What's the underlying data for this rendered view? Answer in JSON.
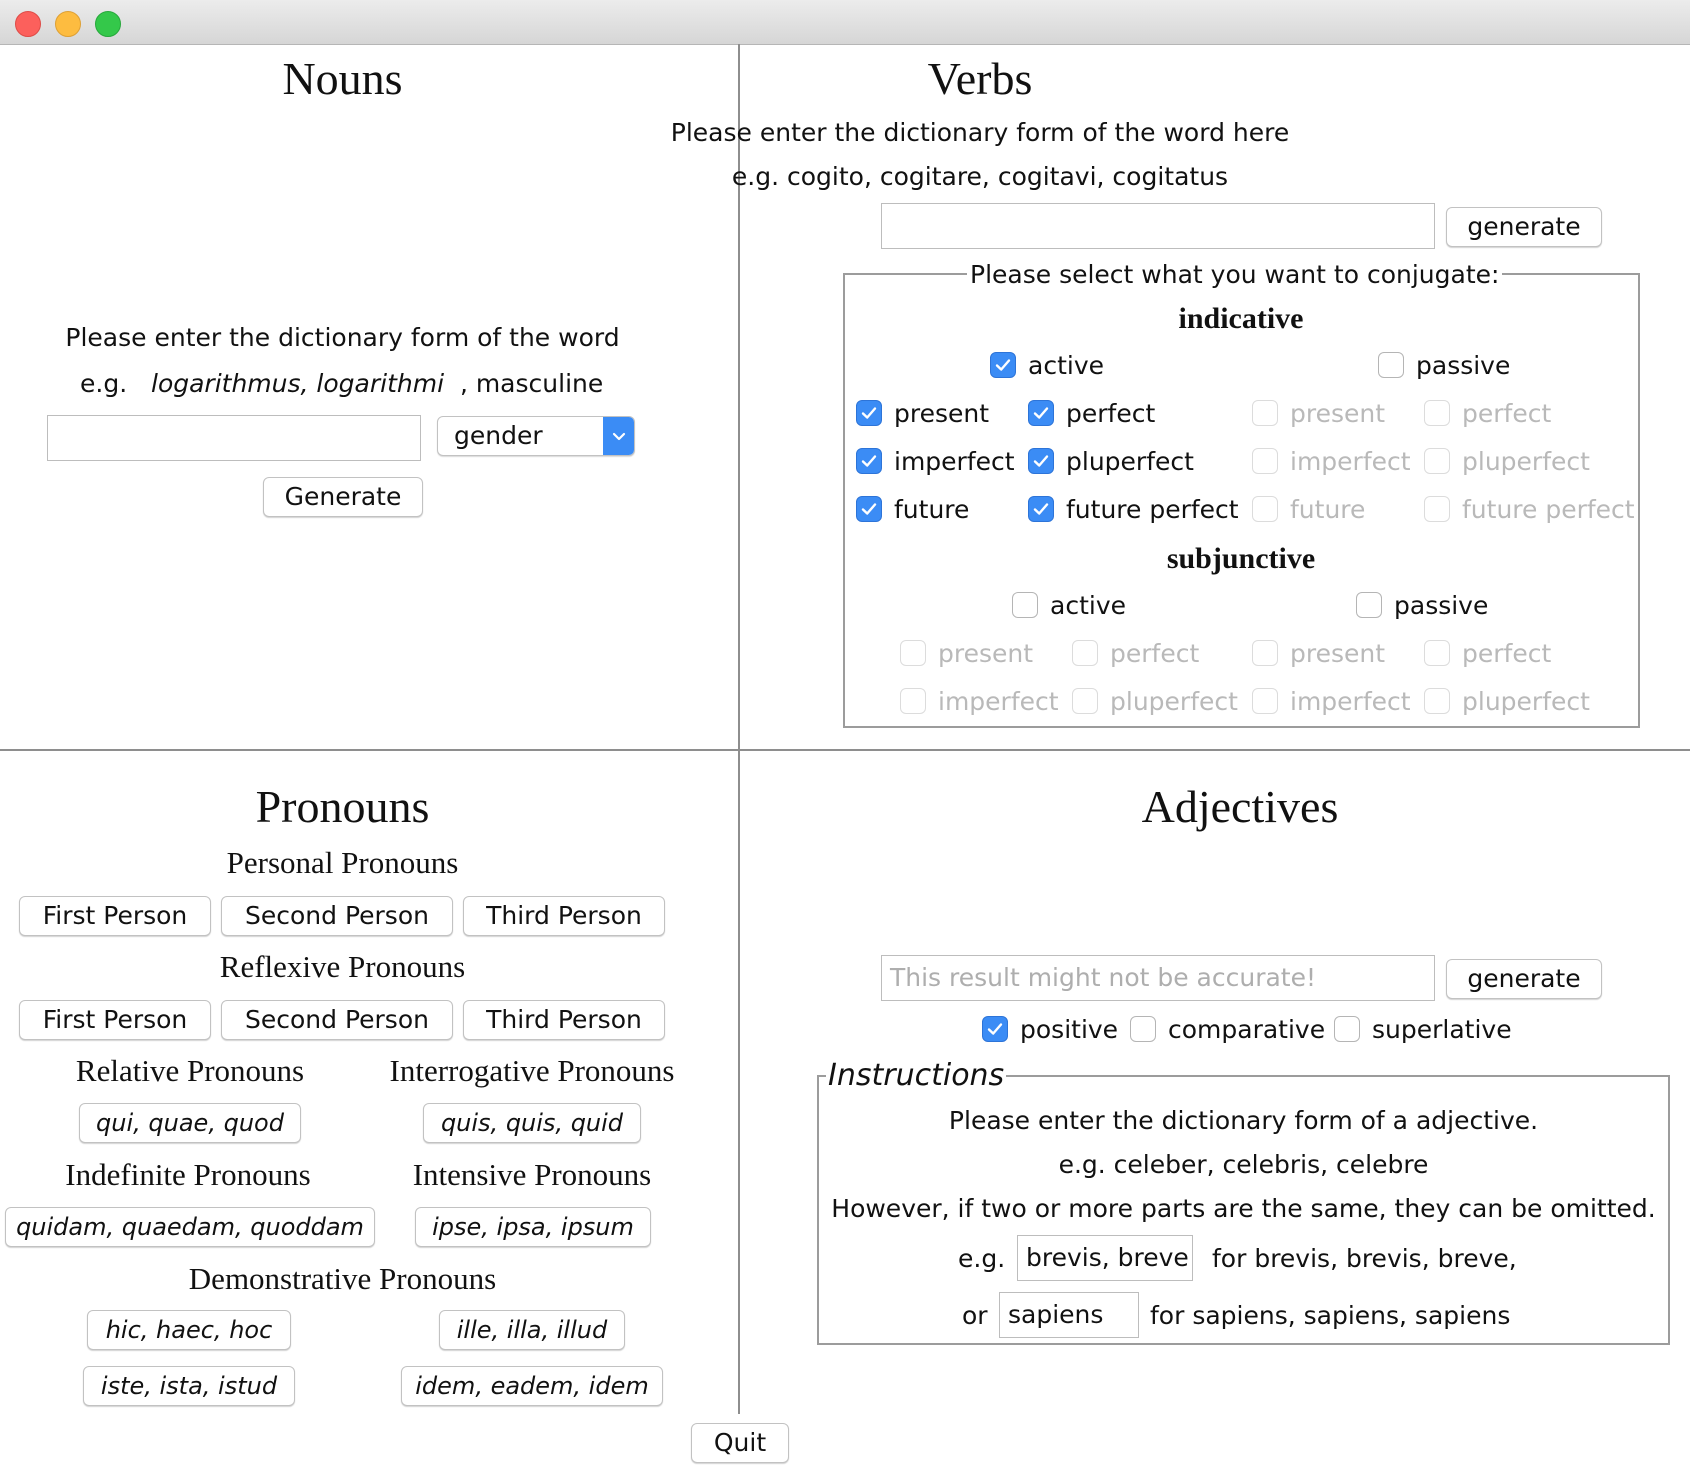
{
  "window": {
    "title": ""
  },
  "nouns": {
    "title": "Nouns",
    "instruction": "Please enter the dictionary form of the word",
    "example_prefix": "e.g.",
    "example_words": "logarithmus, logarithmi",
    "example_suffix": ", masculine",
    "input_value": "",
    "gender_select": "gender",
    "generate_label": "Generate"
  },
  "verbs": {
    "title": "Verbs",
    "instruction": "Please enter the dictionary form of the word here",
    "example": "e.g. cogito, cogitare, cogitavi, cogitatus",
    "input_value": "",
    "generate_label": "generate",
    "group_label": "Please select what you want to conjugate:",
    "indicative": {
      "label": "indicative",
      "active": {
        "label": "active",
        "checked": true
      },
      "passive": {
        "label": "passive",
        "checked": false
      },
      "active_tenses": {
        "present": {
          "label": "present",
          "checked": true
        },
        "perfect": {
          "label": "perfect",
          "checked": true
        },
        "imperfect": {
          "label": "imperfect",
          "checked": true
        },
        "pluperfect": {
          "label": "pluperfect",
          "checked": true
        },
        "future": {
          "label": "future",
          "checked": true
        },
        "future_perfect": {
          "label": "future perfect",
          "checked": true
        }
      },
      "passive_tenses": {
        "present": {
          "label": "present",
          "checked": false,
          "enabled": false
        },
        "perfect": {
          "label": "perfect",
          "checked": false,
          "enabled": false
        },
        "imperfect": {
          "label": "imperfect",
          "checked": false,
          "enabled": false
        },
        "pluperfect": {
          "label": "pluperfect",
          "checked": false,
          "enabled": false
        },
        "future": {
          "label": "future",
          "checked": false,
          "enabled": false
        },
        "future_perfect": {
          "label": "future perfect",
          "checked": false,
          "enabled": false
        }
      }
    },
    "subjunctive": {
      "label": "subjunctive",
      "active": {
        "label": "active",
        "checked": false
      },
      "passive": {
        "label": "passive",
        "checked": false
      },
      "active_tenses": {
        "present": {
          "label": "present",
          "checked": false,
          "enabled": false
        },
        "perfect": {
          "label": "perfect",
          "checked": false,
          "enabled": false
        },
        "imperfect": {
          "label": "imperfect",
          "checked": false,
          "enabled": false
        },
        "pluperfect": {
          "label": "pluperfect",
          "checked": false,
          "enabled": false
        }
      },
      "passive_tenses": {
        "present": {
          "label": "present",
          "checked": false,
          "enabled": false
        },
        "perfect": {
          "label": "perfect",
          "checked": false,
          "enabled": false
        },
        "imperfect": {
          "label": "imperfect",
          "checked": false,
          "enabled": false
        },
        "pluperfect": {
          "label": "pluperfect",
          "checked": false,
          "enabled": false
        }
      }
    }
  },
  "pronouns": {
    "title": "Pronouns",
    "personal": {
      "label": "Personal Pronouns",
      "first": "First Person",
      "second": "Second Person",
      "third": "Third Person"
    },
    "reflexive": {
      "label": "Reflexive Pronouns",
      "first": "First Person",
      "second": "Second Person",
      "third": "Third Person"
    },
    "relative": {
      "label": "Relative Pronouns",
      "button": "qui, quae, quod"
    },
    "interrogative": {
      "label": "Interrogative Pronouns",
      "button": "quis, quis, quid"
    },
    "indefinite": {
      "label": "Indefinite Pronouns",
      "button": "quidam, quaedam, quoddam"
    },
    "intensive": {
      "label": "Intensive Pronouns",
      "button": "ipse, ipsa, ipsum"
    },
    "demonstrative": {
      "label": "Demonstrative Pronouns",
      "hic": "hic, haec, hoc",
      "ille": "ille, illa, illud",
      "iste": "iste, ista, istud",
      "idem": "idem, eadem, idem"
    }
  },
  "adjectives": {
    "title": "Adjectives",
    "input_placeholder": "This result might not be accurate!",
    "generate_label": "generate",
    "positive": {
      "label": "positive",
      "checked": true
    },
    "comparative": {
      "label": "comparative",
      "checked": false
    },
    "superlative": {
      "label": "superlative",
      "checked": false
    },
    "instructions": {
      "label": "Instructions",
      "line1": "Please enter the dictionary form of a adjective.",
      "line2": "e.g. celeber, celebris, celebre",
      "line3": "However, if two or more parts are the same, they can be omitted.",
      "example1_prefix": "e.g.",
      "example1_field": "brevis, breve",
      "example1_suffix": "for brevis, brevis, breve,",
      "example2_prefix": "or",
      "example2_field": "sapiens",
      "example2_suffix": "for sapiens, sapiens, sapiens"
    }
  },
  "quit_label": "Quit",
  "colors": {
    "checkbox_accent": "#3b8cf5",
    "disabled_text": "#b9b9b9",
    "divider": "#8e8e8e"
  },
  "icons": {
    "checkmark": "check-icon",
    "dropdown": "chevron-down-icon"
  }
}
